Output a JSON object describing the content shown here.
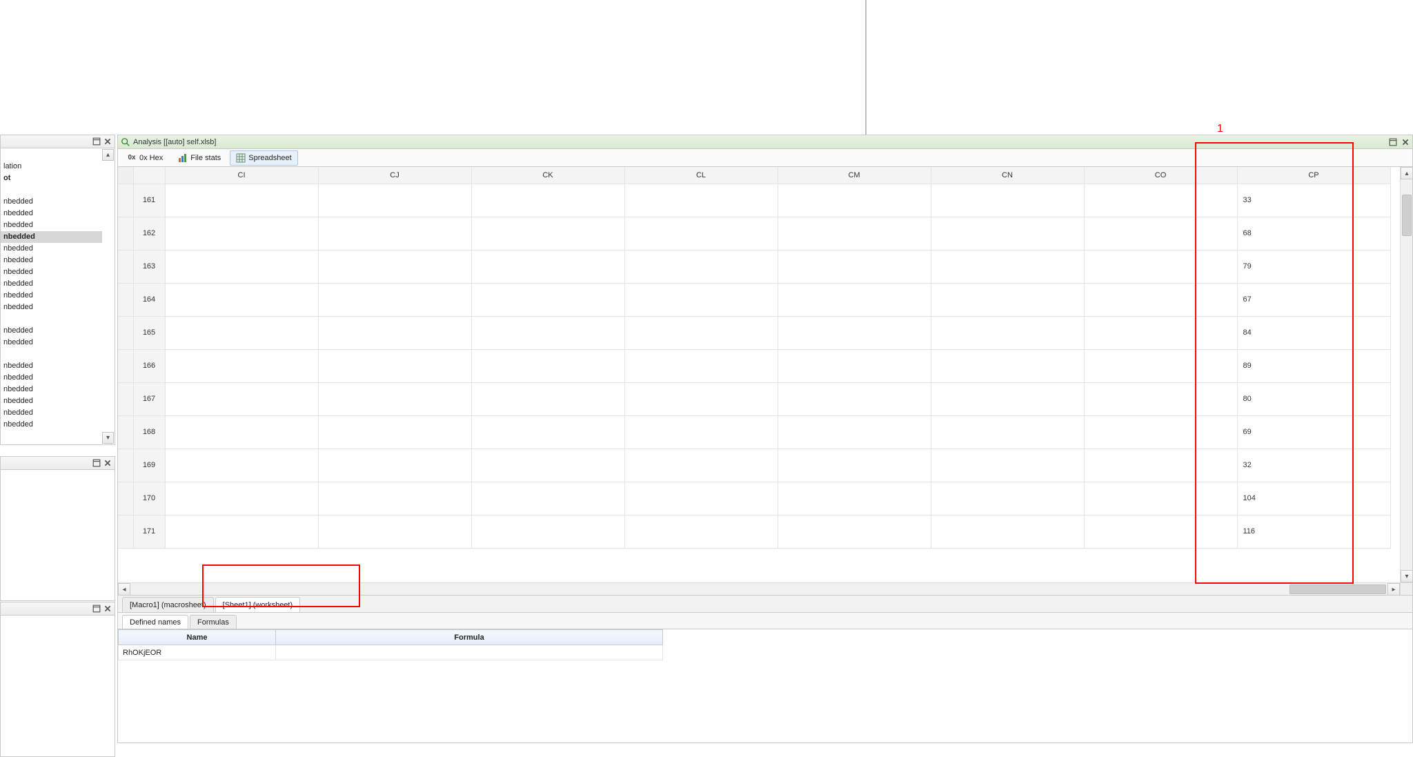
{
  "analysis": {
    "title": "Analysis [[auto] self.xlsb]",
    "toolbar": {
      "hex": "0x Hex",
      "filestats": "File stats",
      "spreadsheet": "Spreadsheet"
    },
    "columns": [
      "CI",
      "CJ",
      "CK",
      "CL",
      "CM",
      "CN",
      "CO",
      "CP"
    ],
    "rows": [
      {
        "n": 161,
        "cp": "33"
      },
      {
        "n": 162,
        "cp": "68"
      },
      {
        "n": 163,
        "cp": "79"
      },
      {
        "n": 164,
        "cp": "67"
      },
      {
        "n": 165,
        "cp": "84"
      },
      {
        "n": 166,
        "cp": "89"
      },
      {
        "n": 167,
        "cp": "80"
      },
      {
        "n": 168,
        "cp": "69"
      },
      {
        "n": 169,
        "cp": "32"
      },
      {
        "n": 170,
        "cp": "104"
      },
      {
        "n": 171,
        "cp": "116"
      }
    ],
    "sheet_tabs": [
      {
        "label": "[Macro1] (macrosheet)",
        "active": false
      },
      {
        "label": "[Sheet1] (worksheet)",
        "active": true
      }
    ],
    "sub_tabs": [
      {
        "label": "Defined names",
        "active": true
      },
      {
        "label": "Formulas",
        "active": false
      }
    ],
    "defined_names": {
      "headers": {
        "name": "Name",
        "formula": "Formula"
      },
      "rows": [
        {
          "name": "RhOKjEOR",
          "formula": ""
        }
      ]
    }
  },
  "sidebar": {
    "header_partial_1": "lation",
    "header_partial_2": "ot",
    "items": [
      "nbedded",
      "nbedded",
      "nbedded",
      "nbedded",
      "nbedded",
      "nbedded",
      "nbedded",
      "nbedded",
      "nbedded",
      "nbedded",
      "",
      "nbedded",
      "nbedded",
      "",
      "nbedded",
      "nbedded",
      "nbedded",
      "nbedded",
      "nbedded",
      "nbedded"
    ],
    "selected_index": 3
  },
  "annotations": {
    "label1": "1"
  }
}
